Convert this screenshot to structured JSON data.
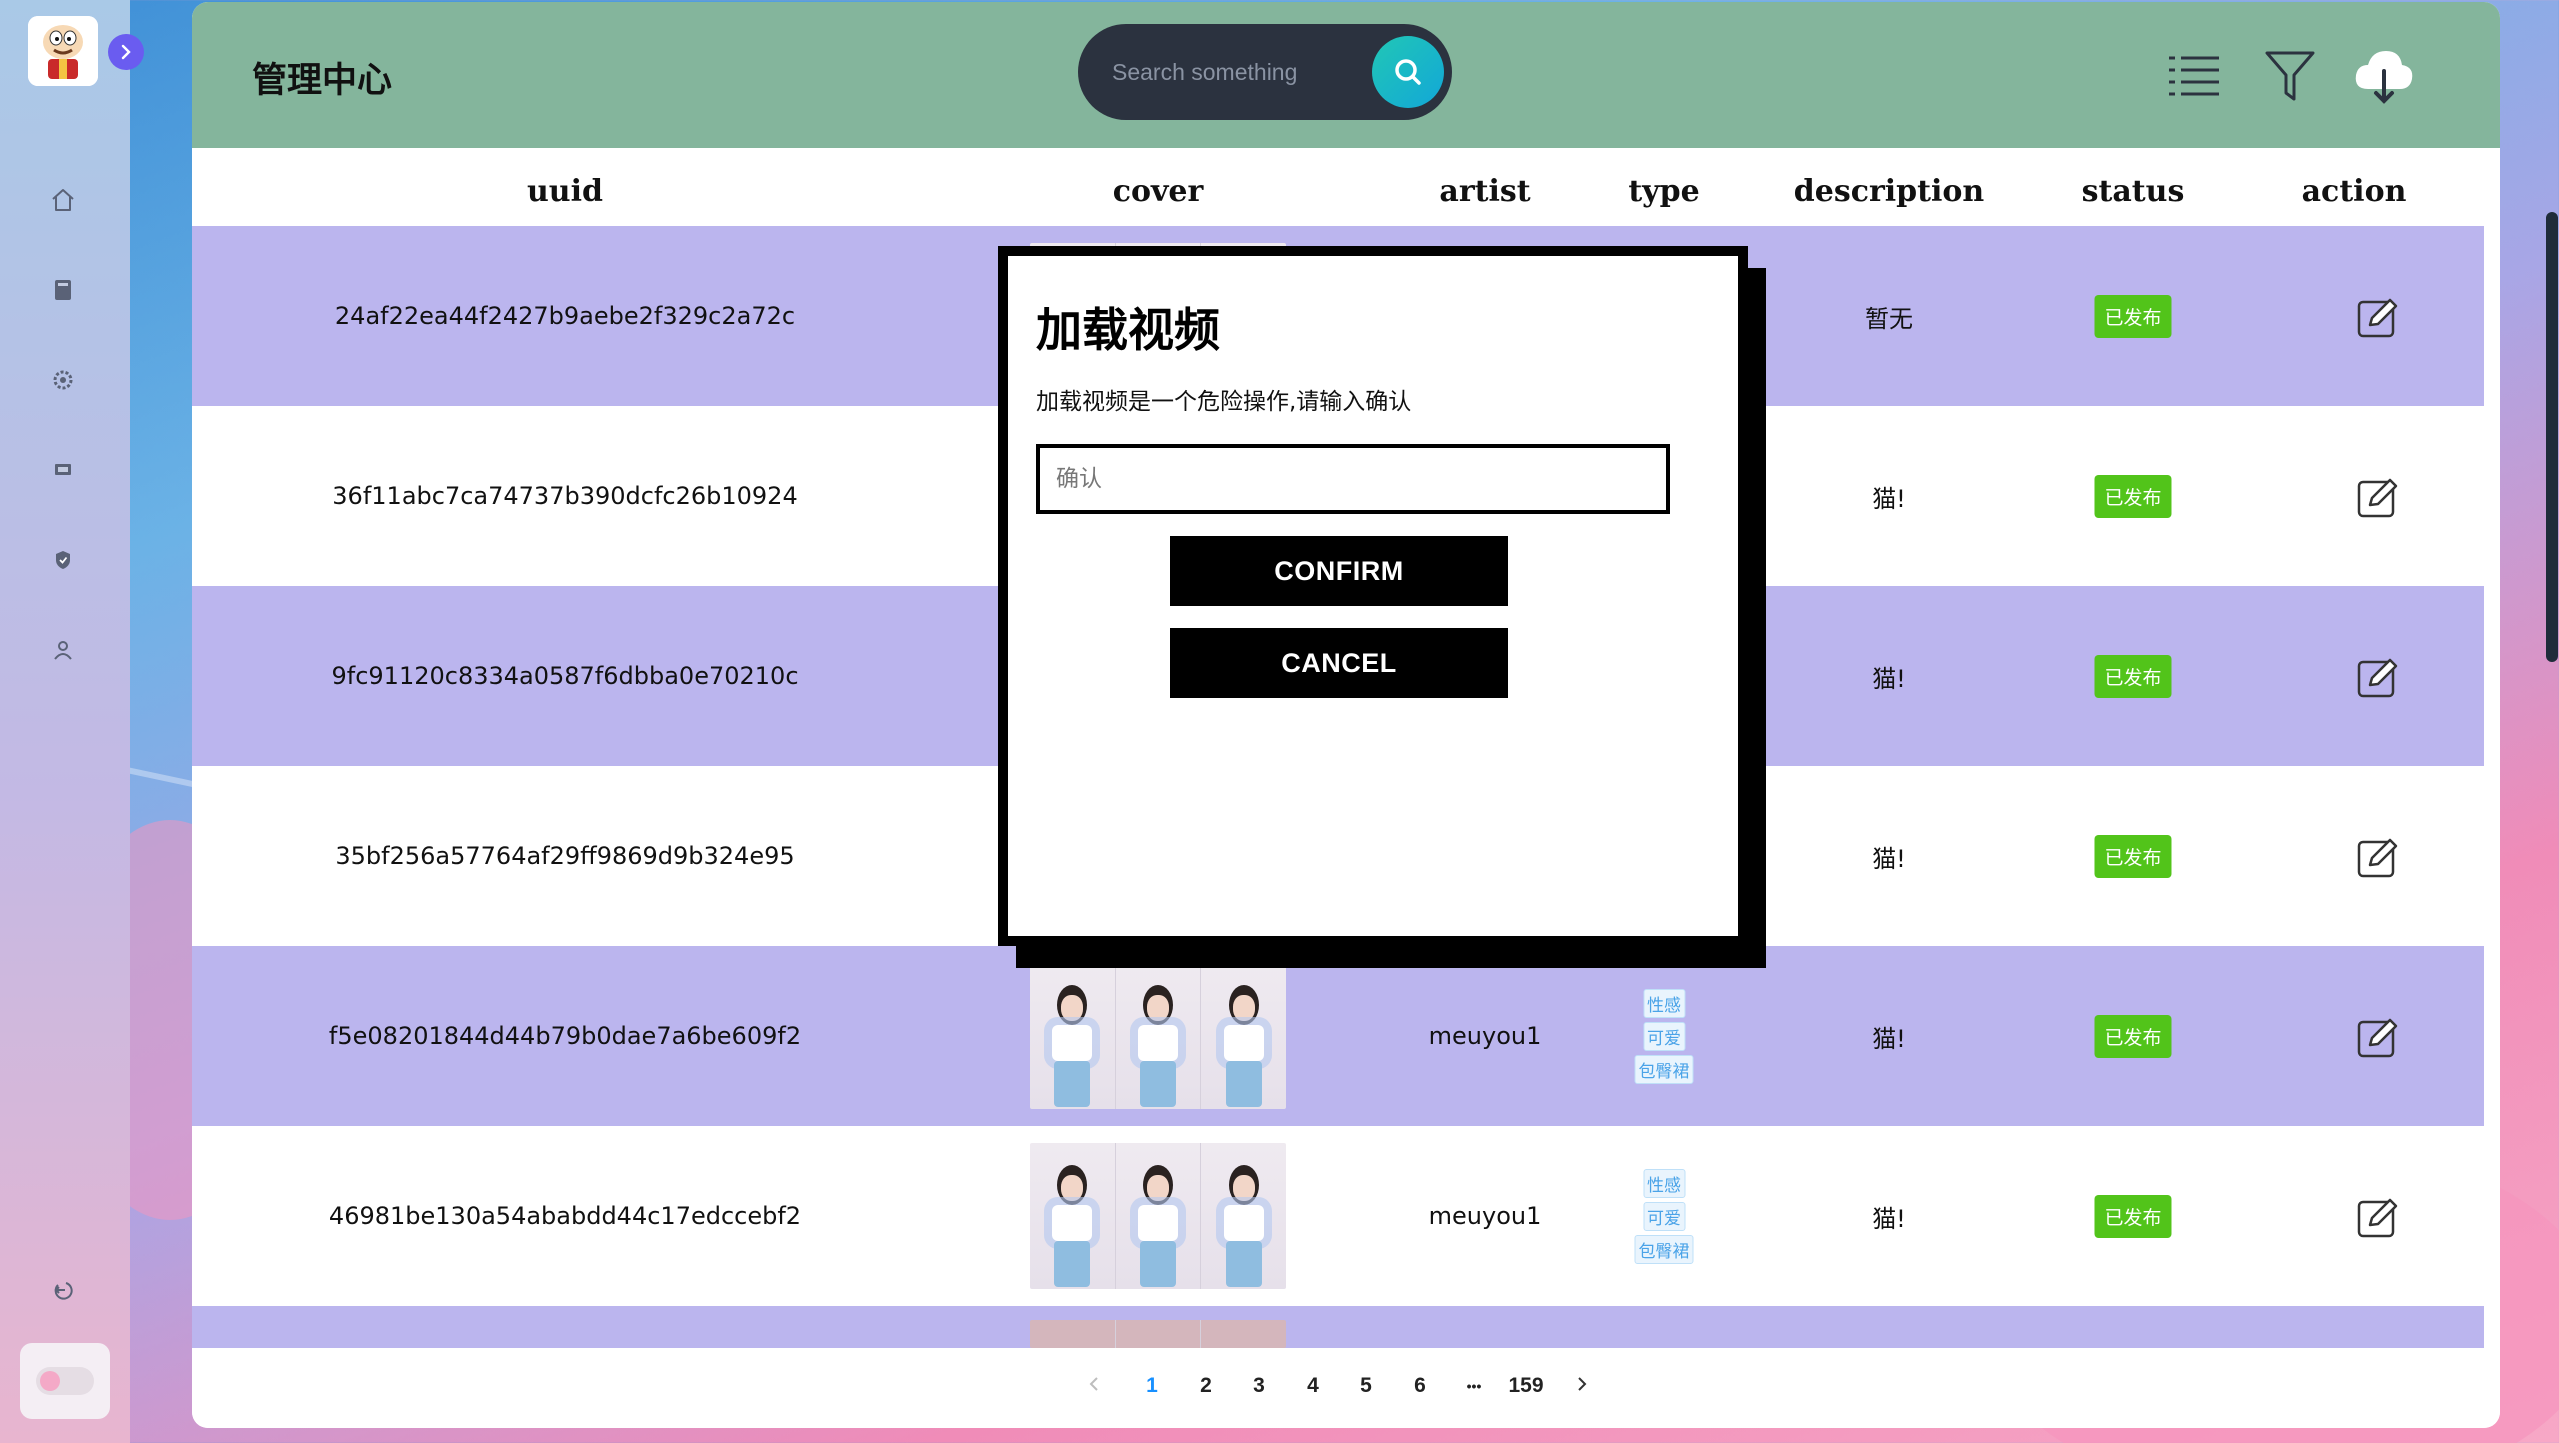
{
  "header": {
    "title": "管理中心",
    "search_placeholder": "Search something"
  },
  "table": {
    "columns": [
      "uuid",
      "cover",
      "artist",
      "type",
      "description",
      "status",
      "action"
    ],
    "rows": [
      {
        "uuid": "24af22ea44f2427b9aebe2f329c2a72c",
        "artist": "",
        "tags": [],
        "description": "暂无",
        "status": "已发布"
      },
      {
        "uuid": "36f11abc7ca74737b390dcfc26b10924",
        "artist": "",
        "tags": [],
        "description": "猫!",
        "status": "已发布"
      },
      {
        "uuid": "9fc91120c8334a0587f6dbba0e70210c",
        "artist": "",
        "tags": [],
        "description": "猫!",
        "status": "已发布"
      },
      {
        "uuid": "35bf256a57764af29ff9869d9b324e95",
        "artist": "",
        "tags": [],
        "description": "猫!",
        "status": "已发布"
      },
      {
        "uuid": "f5e08201844d44b79b0dae7a6be609f2",
        "artist": "meuyou1",
        "tags": [
          "性感",
          "可爱",
          "包臀裙"
        ],
        "description": "猫!",
        "status": "已发布"
      },
      {
        "uuid": "46981be130a54ababdd44c17edccebf2",
        "artist": "meuyou1",
        "tags": [
          "性感",
          "可爱",
          "包臀裙"
        ],
        "description": "猫!",
        "status": "已发布"
      }
    ]
  },
  "pagination": {
    "pages": [
      "1",
      "2",
      "3",
      "4",
      "5",
      "6"
    ],
    "ellipsis": "•••",
    "last": "159",
    "current": "1"
  },
  "modal": {
    "title": "加载视频",
    "message": "加载视频是一个危险操作,请输入确认",
    "input_placeholder": "确认",
    "confirm_label": "CONFIRM",
    "cancel_label": "CANCEL"
  },
  "colors": {
    "header_bg": "#84b59c",
    "row_alt_bg": "#bbb5ee",
    "status_green": "#52c41a",
    "accent_blue": "#1890ff"
  },
  "icons": [
    "home-icon",
    "book-icon",
    "gear-icon",
    "monitor-icon",
    "shield-icon",
    "user-icon",
    "logout-icon",
    "menu-list-icon",
    "filter-icon",
    "cloud-upload-icon",
    "search-icon",
    "edit-icon"
  ]
}
